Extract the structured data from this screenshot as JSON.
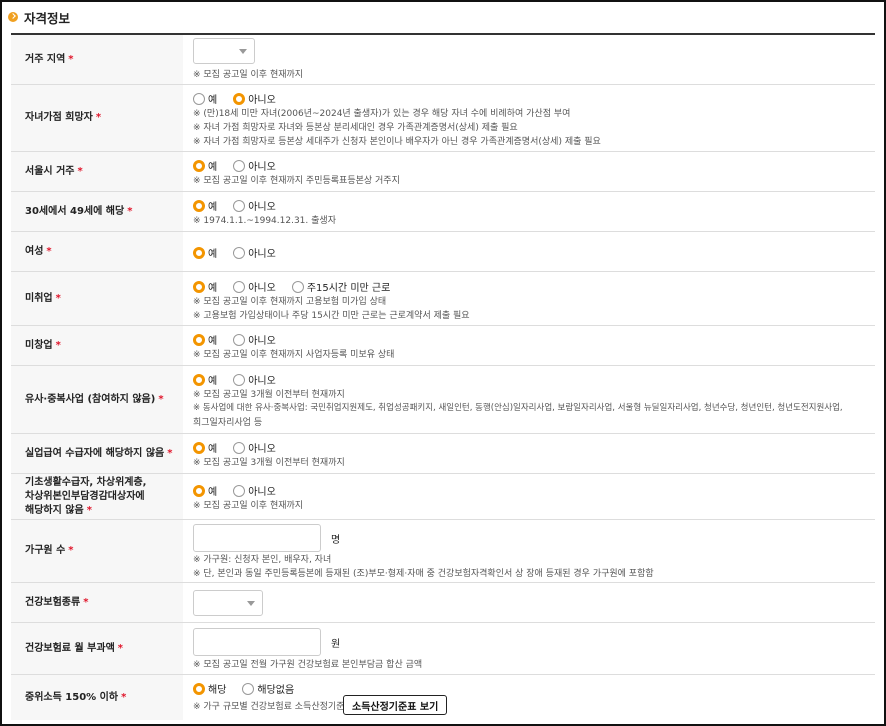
{
  "section": {
    "title": "자격정보"
  },
  "rows": [
    {
      "label": "거주 지역",
      "notes": [
        "※ 모집 공고일 이후 현재까지"
      ]
    },
    {
      "label": "자녀가점 희망자",
      "radios": [
        "예",
        "아니오"
      ],
      "selected": "아니오",
      "notes": [
        "※ (만)18세 미만 자녀(2006년~2024년 출생자)가 있는 경우 해당 자녀 수에 비례하여 가산점 부여",
        "※ 자녀 가점 희망자로 자녀와 등본상 분리세대인 경우 가족관계증명서(상세) 제출 필요",
        "※ 자녀 가점 희망자로 등본상 세대주가 신청자 본인이나 배우자가 아닌 경우 가족관계증명서(상세) 제출 필요"
      ]
    },
    {
      "label": "서울시 거주",
      "radios": [
        "예",
        "아니오"
      ],
      "selected": "예",
      "notes": [
        "※ 모집 공고일 이후 현재까지 주민등록표등본상 거주지"
      ]
    },
    {
      "label": "30세에서 49세에 해당",
      "radios": [
        "예",
        "아니오"
      ],
      "selected": "예",
      "notes": [
        "※ 1974.1.1.~1994.12.31. 출생자"
      ]
    },
    {
      "label": "여성",
      "radios": [
        "예",
        "아니오"
      ],
      "selected": "예",
      "notes": []
    },
    {
      "label": "미취업",
      "radios": [
        "예",
        "아니오",
        "주15시간 미만 근로"
      ],
      "selected": "예",
      "notes": [
        "※ 모집 공고일 이후 현재까지 고용보험 미가입 상태",
        "※ 고용보험 가입상태이나 주당 15시간 미만 근로는 근로계약서 제출 필요"
      ]
    },
    {
      "label": "미창업",
      "radios": [
        "예",
        "아니오"
      ],
      "selected": "예",
      "notes": [
        "※ 모집 공고일 이후 현재까지 사업자등록 미보유 상태"
      ]
    },
    {
      "label": "유사·중복사업 (참여하지 않음)",
      "radios": [
        "예",
        "아니오"
      ],
      "selected": "예",
      "notes": [
        "※ 모집 공고일 3개월 이전부터 현재까지",
        "※ 동사업에 대한 유사·중복사업: 국민취업지원제도, 취업성공패키지, 새일인턴, 동행(안심)일자리사업, 보람일자리사업, 서울형 뉴딜일자리사업, 청년수당, 청년인턴, 청년도전지원사업,",
        "   희그일자리사업 등"
      ]
    },
    {
      "label": "실업급여 수급자에 해당하지 않음",
      "radios": [
        "예",
        "아니오"
      ],
      "selected": "예",
      "notes": [
        "※ 모집 공고일 3개월 이전부터 현재까지"
      ]
    },
    {
      "label_lines": [
        "기초생활수급자, 차상위계층,",
        "차상위본인부담경감대상자에",
        "해당하지 않음"
      ],
      "radios": [
        "예",
        "아니오"
      ],
      "selected": "예",
      "notes": [
        "※ 모집 공고일 이후 현재까지"
      ]
    },
    {
      "label": "가구원 수",
      "unit": "명",
      "notes": [
        "※ 가구원: 신청자 본인, 배우자, 자녀",
        "※ 단, 본인과 동일 주민등록등본에 등재된 (조)부모·형제·자매 중 건강보험자격확인서 상 장애 등재된 경우 가구원에 포함함"
      ]
    },
    {
      "label": "건강보험종류",
      "notes": []
    },
    {
      "label": "건강보험료 월 부과액",
      "unit": "원",
      "notes": [
        "※ 모집 공고일 전월 가구원 건강보험료 본인부담금 합산 금액"
      ]
    },
    {
      "label": "중위소득 150% 이하",
      "radios": [
        "해당",
        "해당없음"
      ],
      "selected": "해당",
      "note_prefix": "※ 가구 규모별 건강보험료 소득산정기준:",
      "button": "소득산정기준표 보기"
    }
  ],
  "colors": {
    "accent": "#f39500",
    "required": "#e0162b",
    "bullet": "#f0a020"
  },
  "icons": [
    "check-circle-icon",
    "chevron-down-icon",
    "radio-selected-icon",
    "radio-unselected-icon"
  ]
}
